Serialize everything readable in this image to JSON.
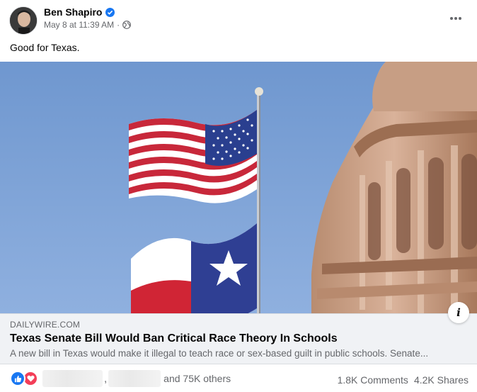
{
  "post": {
    "author": "Ben Shapiro",
    "timestamp": "May 8 at 11:39 AM",
    "separator": "·",
    "caption": "Good for Texas."
  },
  "link_preview": {
    "domain": "DAILYWIRE.COM",
    "headline": "Texas Senate Bill Would Ban Critical Race Theory In Schools",
    "description": "A new bill in Texas would make it illegal to teach race or sex-based guilt in public schools. Senate..."
  },
  "reactions": {
    "icons": [
      "like-icon",
      "love-icon"
    ],
    "separator": ",",
    "others_text": "and 75K others",
    "comments": "1.8K Comments",
    "shares": "4.2K Shares"
  },
  "colors": {
    "like": "#1877f2",
    "love": "#f33e58",
    "verified": "#1877f2",
    "secondary_text": "#65676b",
    "link_bg": "#f0f2f5"
  }
}
